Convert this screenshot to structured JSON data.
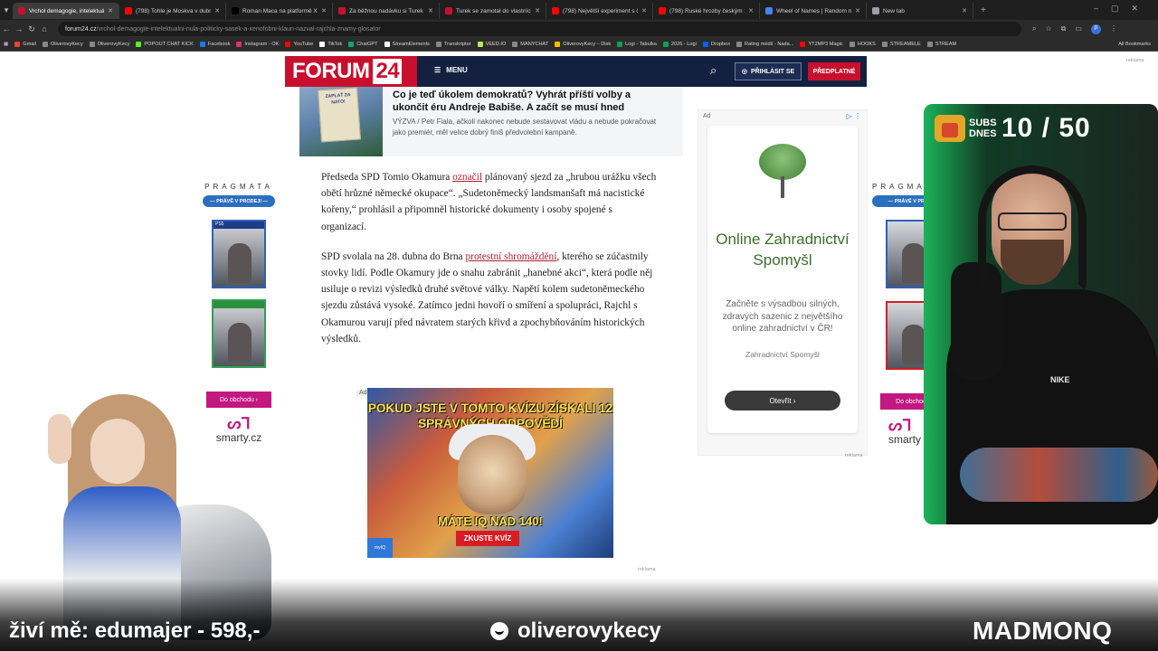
{
  "browser": {
    "tabs": [
      {
        "title": "Vrchol demagogie, intelektuální...",
        "color": "#c8102e",
        "active": true
      },
      {
        "title": "(798) Tohle je Moskva v dubnu...",
        "color": "#ff0000",
        "active": false
      },
      {
        "title": "Roman Maca na platformě X...",
        "color": "#000000",
        "active": false
      },
      {
        "title": "Za běžnou nadávku si Turek vy...",
        "color": "#c8102e",
        "active": false
      },
      {
        "title": "Turek se zamotal do vlastních l...",
        "color": "#c8102e",
        "active": false
      },
      {
        "title": "(798) Největší experiment s čes...",
        "color": "#ff0000",
        "active": false
      },
      {
        "title": "(798) Ruské hrozby českým zbr...",
        "color": "#ff0000",
        "active": false
      },
      {
        "title": "Wheel of Names | Random nam...",
        "color": "#4285f4",
        "active": false
      },
      {
        "title": "New tab",
        "color": "#9aa0a6",
        "active": false
      }
    ],
    "url_domain": "forum24.cz",
    "url_path": "/vrchol-demagogie-intelektualni-nula-politicky-sasek-a-xenofobni-klaun-nazval-rajchla-znamy-glosator",
    "bookmarks": [
      {
        "label": "Gmail",
        "color": "#ea4335"
      },
      {
        "label": "OliverovyKecy",
        "color": "#888888"
      },
      {
        "label": "OliverovyKecy",
        "color": "#888888"
      },
      {
        "label": "POPOUT CHAT KICK",
        "color": "#53fc18"
      },
      {
        "label": "Facebook",
        "color": "#1877f2"
      },
      {
        "label": "Instagram - OK",
        "color": "#e1306c"
      },
      {
        "label": "YouTube",
        "color": "#ff0000"
      },
      {
        "label": "TikTok",
        "color": "#ffffff"
      },
      {
        "label": "ChatGPT",
        "color": "#10a37f"
      },
      {
        "label": "StreamElements",
        "color": "#ffffff"
      },
      {
        "label": "Transkriptor",
        "color": "#888888"
      },
      {
        "label": "VEED.IO",
        "color": "#b6e85f"
      },
      {
        "label": "MANYCHAT",
        "color": "#888888"
      },
      {
        "label": "OliverovyKecy – Disk",
        "color": "#fbbc04"
      },
      {
        "label": "Logi - Tabulka",
        "color": "#0f9d58"
      },
      {
        "label": "2026 - Logi",
        "color": "#0f9d58"
      },
      {
        "label": "Dropbox",
        "color": "#0061ff"
      },
      {
        "label": "Rating médií - Nada...",
        "color": "#888888"
      },
      {
        "label": "YT2MP3 Magic",
        "color": "#ff0000"
      },
      {
        "label": "HOOKS",
        "color": "#888888"
      },
      {
        "label": "STREAMELE",
        "color": "#888888"
      },
      {
        "label": "STREAM",
        "color": "#888888"
      }
    ],
    "all_bookmarks": "All Bookmarks",
    "profile_initial": "P"
  },
  "site": {
    "logo_text": "FORUM",
    "logo_num": "24",
    "menu": "MENU",
    "login": "PŘIHLÁSIT SE",
    "subscribe": "PŘEDPLATNÉ",
    "reklama": "reklama"
  },
  "related": {
    "sign_text": "ZAPLAŤ ZA NATO!",
    "title": "Co je teď úkolem demokratů? Vyhrát příští volby a ukončit éru Andreje Babiše. A začít se musí hned",
    "desc": "VÝZVA / Petr Fiala, ačkoli nakonec nebude sestavovat vládu a nebude pokračovat jako premiér, měl velice dobrý finiš předvolební kampaně."
  },
  "article": {
    "p1_a": "Předseda SPD Tomio Okamura ",
    "p1_link": "označil",
    "p1_b": " plánovaný sjezd za „hrubou urážku všech obětí hrůzné německé okupace“. „Sudetoněmecký landsmanšaft má nacistické kořeny,“ prohlásil a připomněl historické dokumenty i osoby spojené s organizací.",
    "p2_a": "SPD svolala na 28. dubna do Brna ",
    "p2_link": "protestní shromáždění",
    "p2_b": ", kterého se zúčastnily stovky lidí. Podle Okamury jde o snahu zabránit „hanebné akci“, která podle něj usiluje o revizi výsledků druhé světové války. Napětí kolem sudetoněmeckého sjezdu zůstává vysoké. Zatímco jedni hovoří o smíření a spolupráci, Rajchl s Okamurou varují před návratem starých křivd a zpochybňováním historických výsledků."
  },
  "left_ad": {
    "brand": "PRAGMATA",
    "tag": "— PRÁVĚ V PRODEJI —",
    "ps5": "PS5",
    "cta": "Do obchodu ›",
    "shop": "smarty.cz"
  },
  "right_ad_partial": {
    "brand": "PRAGMATA",
    "tag": "— PRÁVĚ V PRO",
    "cta": "Do obchodu",
    "shop": "smarty"
  },
  "side_ad": {
    "tag": "Ad",
    "title": "Online Zahradnictví Spomyšl",
    "desc": "Začněte s výsadbou silných, zdravých sazenic z největšího online zahradnictví v ČR!",
    "brand": "Zahradnictví Spomyšl",
    "button": "Otevřít ›"
  },
  "mid_ad": {
    "tag": "Ad",
    "headline": "POKUD JSTE V TOMTO KVÍZU ZÍSKALI 12 SPRÁVNÝCH ODPOVĚDÍ",
    "iq": "MÁTE IQ NAD 140!",
    "button": "ZKUSTE KVÍZ",
    "brand": "myIQ"
  },
  "overlay": {
    "subs_label": "SUBS DNES",
    "subs_count": "10 / 50",
    "shirt_brand": "NIKE",
    "donation": "živí mě: edumajer - 598,-",
    "channel": "oliverovykecy",
    "brand": "MADMONQ"
  }
}
